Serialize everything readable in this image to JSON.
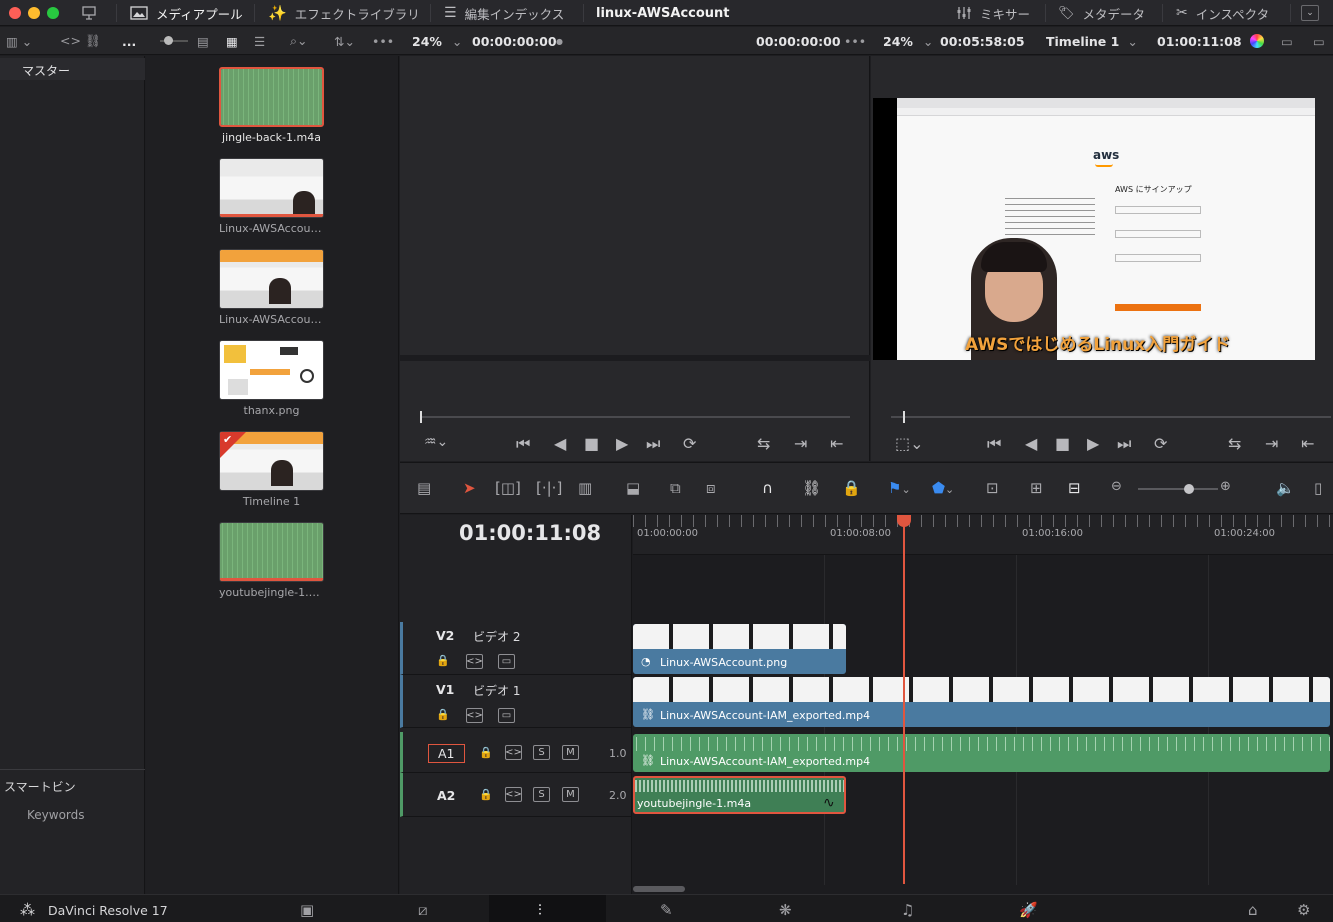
{
  "window": {
    "title": "linux-AWSAccount"
  },
  "topbar": {
    "media_pool": "メディアプール",
    "effects": "エフェクトライブラリ",
    "edit_index": "編集インデックス",
    "mixer": "ミキサー",
    "metadata": "メタデータ",
    "inspector": "インスペクタ"
  },
  "toolbar2": {
    "dots": "...",
    "zoom_left": "24%",
    "tc_left_a": "00:00:00:00",
    "tc_left_b": "00:00:00:00",
    "zoom_right": "24%",
    "tc_right_dur": "00:05:58:05",
    "timeline_name": "Timeline 1",
    "tc_right_pos": "01:00:11:08"
  },
  "leftpanel": {
    "master": "マスター",
    "smart_bins": "スマートビン",
    "keywords": "Keywords"
  },
  "media": [
    {
      "name": "jingle-back-1.m4a",
      "kind": "audio"
    },
    {
      "name": "Linux-AWSAccoun...",
      "kind": "video"
    },
    {
      "name": "Linux-AWSAccoun...",
      "kind": "video"
    },
    {
      "name": "thanx.png",
      "kind": "image"
    },
    {
      "name": "Timeline 1",
      "kind": "timeline"
    },
    {
      "name": "youtubejingle-1.m...",
      "kind": "audio"
    }
  ],
  "viewer": {
    "aws_logo": "aws",
    "signin": "AWS にサインアップ",
    "caption": "AWSではじめるLinux入門ガイド"
  },
  "timeline": {
    "timecode": "01:00:11:08",
    "ruler": [
      "01:00:00:00",
      "01:00:08:00",
      "01:00:16:00",
      "01:00:24:00"
    ],
    "tracks": [
      {
        "id": "V2",
        "title": "ビデオ 2",
        "clip": "Linux-AWSAccount.png"
      },
      {
        "id": "V1",
        "title": "ビデオ 1",
        "clip": "Linux-AWSAccount-IAM_exported.mp4"
      },
      {
        "id": "A1",
        "level": "1.0",
        "clip": "Linux-AWSAccount-IAM_exported.mp4"
      },
      {
        "id": "A2",
        "level": "2.0",
        "clip": "youtubejingle-1.m4a"
      }
    ],
    "s_label": "S",
    "m_label": "M"
  },
  "bottombar": {
    "app_name": "DaVinci Resolve 17"
  },
  "colors": {
    "accent": "#e0563f",
    "video_clip": "#4a7aa0",
    "audio_clip": "#4f9a66",
    "playhead": "#e0563f"
  }
}
